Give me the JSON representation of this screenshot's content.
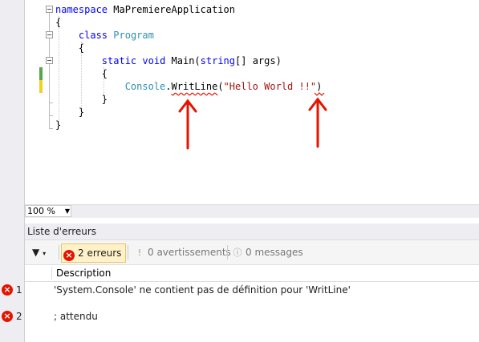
{
  "editor": {
    "lines": [
      {
        "kw": "namespace",
        "rest": " MaPremiereApplication"
      },
      {
        "text": "{"
      },
      {
        "kw": "class",
        "ty": "Program"
      },
      {
        "text": "{"
      },
      {
        "kw1": "static",
        "kw2": "void",
        "name": " Main(",
        "kw3": "string",
        "rest": "[] args)"
      },
      {
        "text": "{"
      },
      {
        "ty": "Console",
        "dot": ".",
        "err": "WritLine",
        "open": "(",
        "str": "\"Hello World !!\"",
        "close": ")"
      },
      {
        "text": "}"
      },
      {
        "text": "}"
      },
      {
        "text": "}"
      }
    ]
  },
  "zoom": {
    "value": "100 %"
  },
  "error_list": {
    "title": "Liste d'erreurs",
    "errors_button": "2 erreurs",
    "warnings_button": "0 avertissements",
    "messages_button": "0 messages",
    "column_description": "Description",
    "rows": [
      {
        "num": "1",
        "desc": "'System.Console' ne contient pas de définition pour 'WritLine'"
      },
      {
        "num": "2",
        "desc": "; attendu"
      }
    ]
  },
  "colors": {
    "error": "#e51400",
    "keyword": "#0000ff",
    "type": "#2b91af",
    "string": "#a31515",
    "arrow": "#e51400"
  }
}
